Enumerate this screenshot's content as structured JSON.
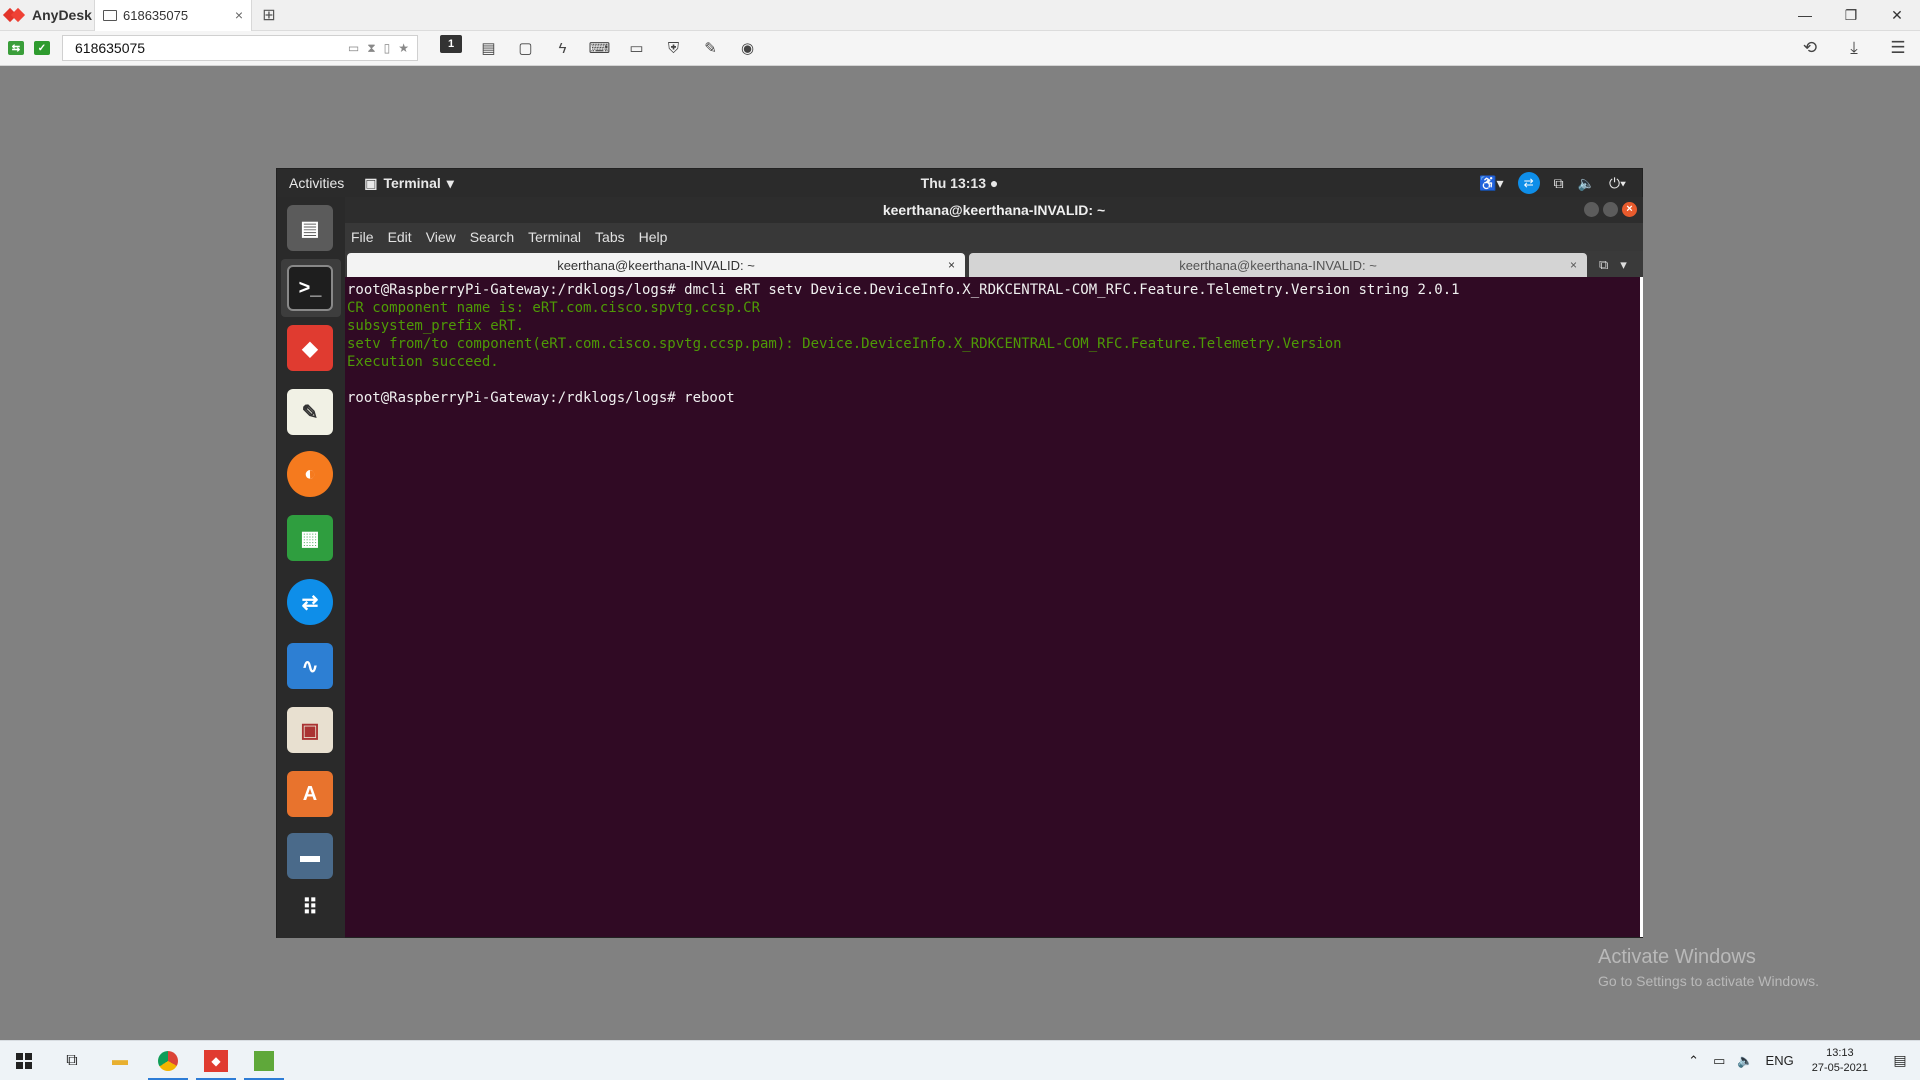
{
  "anydesk": {
    "app_name": "AnyDesk",
    "tab_label": "618635075",
    "tab_close": "×",
    "new_tab": "⊞",
    "window_controls": {
      "minimize": "—",
      "restore": "❐",
      "close": "✕"
    },
    "address_value": "618635075",
    "toolbar_display_number": "1",
    "right_icons": {
      "history": "⟲",
      "download": "⤓",
      "menu": "☰"
    }
  },
  "remote": {
    "topbar": {
      "activities": "Activities",
      "app_menu": "Terminal",
      "clock": "Thu 13:13"
    },
    "terminal": {
      "window_title": "keerthana@keerthana-INVALID: ~",
      "menu": [
        "File",
        "Edit",
        "View",
        "Search",
        "Terminal",
        "Tabs",
        "Help"
      ],
      "tabs": [
        {
          "label": "keerthana@keerthana-INVALID: ~",
          "active": true
        },
        {
          "label": "keerthana@keerthana-INVALID: ~",
          "active": false
        }
      ],
      "tab_close": "×",
      "lines": [
        {
          "text": "root@RaspberryPi-Gateway:/rdklogs/logs# dmcli eRT setv Device.DeviceInfo.X_RDKCENTRAL-COM_RFC.Feature.Telemetry.Version string 2.0.1",
          "color": "white"
        },
        {
          "text": "CR component name is: eRT.com.cisco.spvtg.ccsp.CR",
          "color": "green"
        },
        {
          "text": "subsystem_prefix eRT.",
          "color": "green"
        },
        {
          "text": "setv from/to component(eRT.com.cisco.spvtg.ccsp.pam): Device.DeviceInfo.X_RDKCENTRAL-COM_RFC.Feature.Telemetry.Version",
          "color": "green"
        },
        {
          "text": "Execution succeed.",
          "color": "green"
        },
        {
          "text": "",
          "color": "white"
        },
        {
          "text": "root@RaspberryPi-Gateway:/rdklogs/logs# reboot",
          "color": "white"
        }
      ]
    }
  },
  "watermark": {
    "title": "Activate Windows",
    "subtitle": "Go to Settings to activate Windows."
  },
  "taskbar": {
    "lang": "ENG",
    "time": "13:13",
    "date": "27-05-2021"
  },
  "colors": {
    "terminal_bg": "#300a24",
    "terminal_green": "#4e9a06",
    "anydesk_red": "#ef4135"
  }
}
